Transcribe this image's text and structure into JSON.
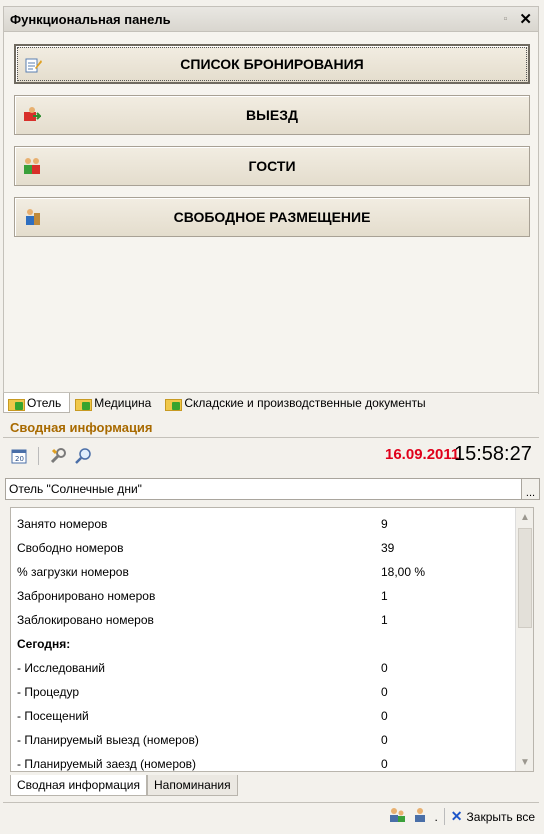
{
  "title": "Функциональная панель",
  "pin_glyph": "▫",
  "close_glyph": "✕",
  "buttons": [
    {
      "label": "СПИСОК БРОНИРОВАНИЯ"
    },
    {
      "label": "ВЫЕЗД"
    },
    {
      "label": "ГОСТИ"
    },
    {
      "label": "СВОБОДНОЕ РАЗМЕЩЕНИЕ"
    }
  ],
  "tabs": [
    {
      "label": "Отель"
    },
    {
      "label": "Медицина"
    },
    {
      "label": "Складские и производственные документы"
    }
  ],
  "summary": {
    "title": "Сводная информация",
    "date": "16.09.2011",
    "time": "15:58:27",
    "hotel": "Отель \"Солнечные дни\"",
    "hotel_button": "...",
    "rows": [
      {
        "k": "Занято номеров",
        "v": "9"
      },
      {
        "k": "Свободно номеров",
        "v": "39"
      },
      {
        "k": "% загрузки номеров",
        "v": "18,00 %"
      },
      {
        "k": "Забронировано номеров",
        "v": "1"
      },
      {
        "k": "Заблокировано номеров",
        "v": "1"
      },
      {
        "k": "Сегодня:",
        "v": ""
      },
      {
        "k": " - Исследований",
        "v": "0"
      },
      {
        "k": " - Процедур",
        "v": "0"
      },
      {
        "k": " - Посещений",
        "v": "0"
      },
      {
        "k": " - Планируемый выезд (номеров)",
        "v": "0"
      },
      {
        "k": " - Планируемый заезд (номеров)",
        "v": "0"
      }
    ]
  },
  "bottom_tabs": [
    {
      "label": "Сводная информация"
    },
    {
      "label": "Напоминания"
    }
  ],
  "status": {
    "dot": ".",
    "close_all": "Закрыть все"
  },
  "colors": {
    "date": "#e0001b",
    "section": "#a86a00",
    "close": "#1c55c9"
  }
}
